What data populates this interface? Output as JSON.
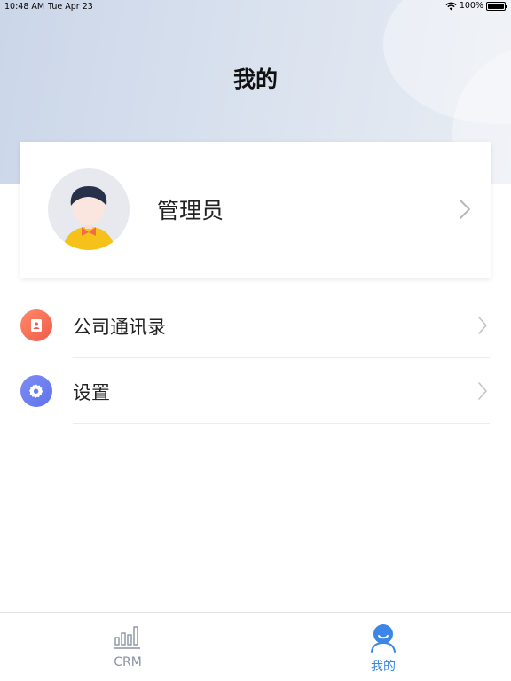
{
  "status_bar": {
    "time": "10:48 AM",
    "date": "Tue Apr 23",
    "battery": "100%",
    "wifi_icon": "wifi-icon",
    "battery_icon": "battery-icon",
    "battery_level": 1.0
  },
  "header": {
    "title": "我的"
  },
  "profile": {
    "name": "管理员",
    "avatar_icon": "user-avatar-icon",
    "chevron_icon": "chevron-right-icon"
  },
  "menu": {
    "items": [
      {
        "label": "公司通讯录",
        "icon": "contacts-book-icon",
        "icon_color": "#f2654f"
      },
      {
        "label": "设置",
        "icon": "settings-gear-icon",
        "icon_color": "#6a7ef0"
      }
    ]
  },
  "tabbar": {
    "tabs": [
      {
        "label": "CRM",
        "icon": "bar-chart-icon",
        "active": false
      },
      {
        "label": "我的",
        "icon": "person-icon",
        "active": true
      }
    ],
    "active_color": "#3b86e6",
    "inactive_color": "#8a93a3"
  }
}
